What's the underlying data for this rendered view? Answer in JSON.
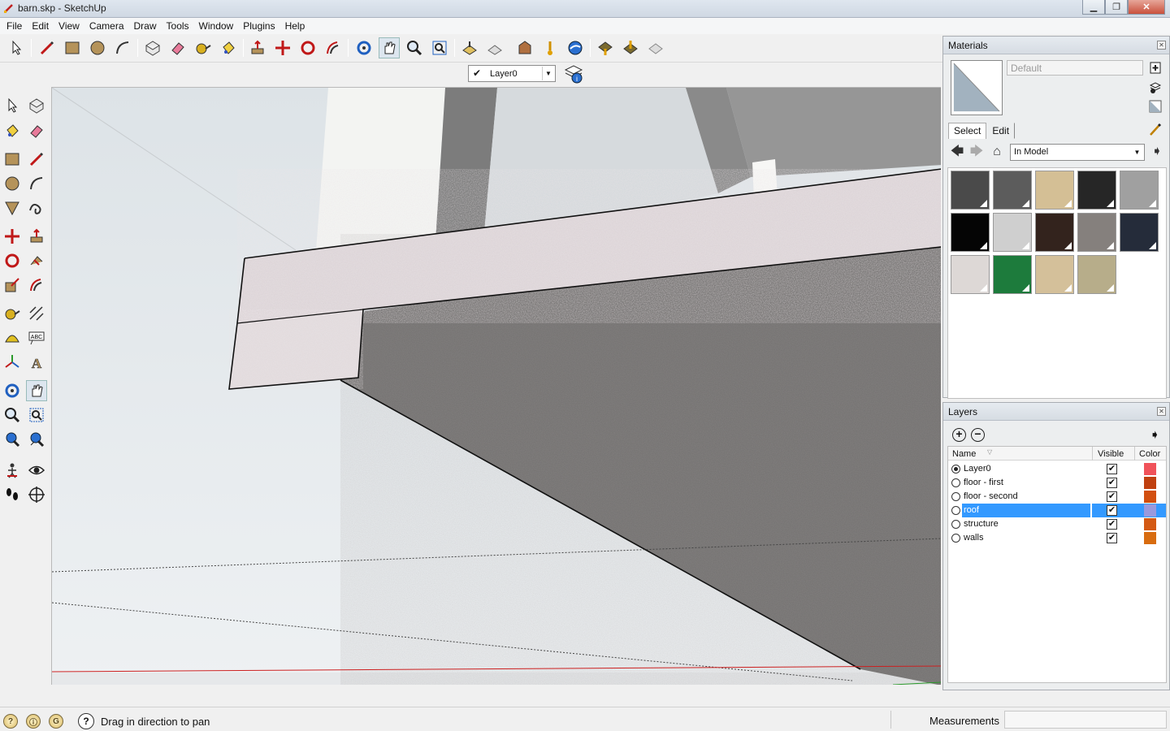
{
  "window": {
    "title": "barn.skp - SketchUp"
  },
  "menu": [
    "File",
    "Edit",
    "View",
    "Camera",
    "Draw",
    "Tools",
    "Window",
    "Plugins",
    "Help"
  ],
  "layer_toolbar": {
    "current_layer": "Layer0"
  },
  "materials": {
    "title": "Materials",
    "name_value": "Default",
    "tabs": [
      "Select",
      "Edit"
    ],
    "collection": "In Model",
    "swatches": [
      "#4a4a4a",
      "#5c5c5c",
      "#d4bf95",
      "#262626",
      "#a0a0a0",
      "#050505",
      "#cfcfcf",
      "#33231d",
      "#85807d",
      "#252c3a",
      "#ddd8d6",
      "#1d7b3c",
      "#d4c09a",
      "#b7ad8a"
    ]
  },
  "layers": {
    "title": "Layers",
    "columns": {
      "name": "Name",
      "visible": "Visible",
      "color": "Color"
    },
    "rows": [
      {
        "name": "Layer0",
        "active": true,
        "visible": true,
        "color": "#f0525a",
        "selected": false
      },
      {
        "name": "floor - first",
        "active": false,
        "visible": true,
        "color": "#c04010",
        "selected": false
      },
      {
        "name": "floor - second",
        "active": false,
        "visible": true,
        "color": "#d24f10",
        "selected": false
      },
      {
        "name": "roof",
        "active": false,
        "visible": true,
        "color": "#9999dd",
        "selected": true
      },
      {
        "name": "structure",
        "active": false,
        "visible": true,
        "color": "#d45a14",
        "selected": false
      },
      {
        "name": "walls",
        "active": false,
        "visible": true,
        "color": "#d86c10",
        "selected": false
      }
    ]
  },
  "status": {
    "message": "Drag in direction to pan",
    "measurements_label": "Measurements",
    "measurements_value": ""
  },
  "colors": {
    "accent": "#3399ff",
    "axis_red": "#cc2020",
    "axis_green": "#2a9a2a"
  }
}
